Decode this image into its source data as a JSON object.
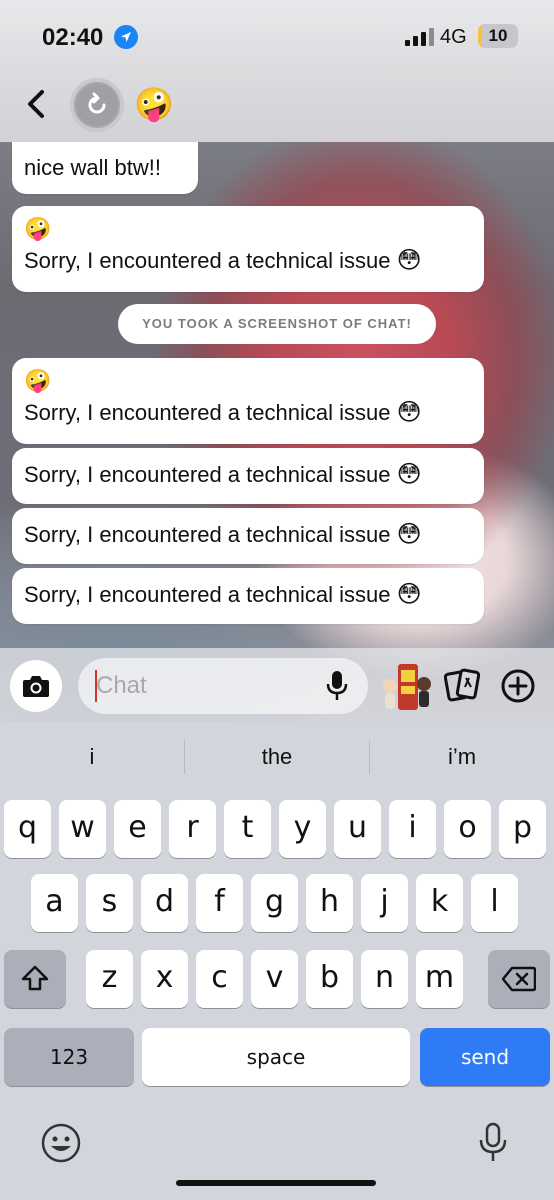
{
  "status_bar": {
    "time": "02:40",
    "network": "4G",
    "battery": "10",
    "battery_level": 0.1
  },
  "header": {
    "emoji": "🤪",
    "back_label": "<"
  },
  "messages": [
    {
      "text": "nice wall btw!!"
    },
    {
      "emoji": "🤪",
      "text": "Sorry, I encountered a technical issue",
      "suffix": "😳"
    },
    {
      "emoji": "🤪",
      "text": "Sorry, I encountered a technical issue",
      "suffix": "😳"
    },
    {
      "text": "Sorry, I encountered a technical issue",
      "suffix": "😳"
    },
    {
      "text": "Sorry, I encountered a technical issue",
      "suffix": "😳"
    },
    {
      "text": "Sorry, I encountered a technical issue",
      "suffix": "😳"
    }
  ],
  "system_notice": "YOU TOOK A SCREENSHOT OF CHAT!",
  "composer": {
    "placeholder": "Chat"
  },
  "keyboard": {
    "predictions": [
      "i",
      "the",
      "i’m"
    ],
    "row1": [
      "q",
      "w",
      "e",
      "r",
      "t",
      "y",
      "u",
      "i",
      "o",
      "p"
    ],
    "row2": [
      "a",
      "s",
      "d",
      "f",
      "g",
      "h",
      "j",
      "k",
      "l"
    ],
    "row3": [
      "z",
      "x",
      "c",
      "v",
      "b",
      "n",
      "m"
    ],
    "numbers_label": "123",
    "space_label": "space",
    "send_label": "send"
  }
}
